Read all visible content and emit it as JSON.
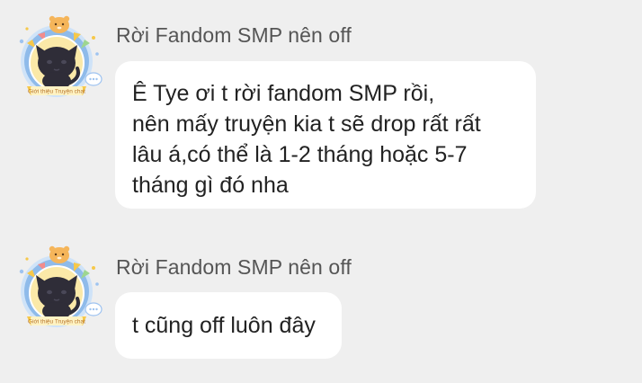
{
  "messages": [
    {
      "sender": "Rời Fandom SMP nên off",
      "lines": [
        "Ê Tye ơi t rời fandom SMP rồi,",
        "nên mấy truyện kia t sẽ drop rất rất",
        "lâu á,có thể là 1-2 tháng hoặc 5-7",
        "tháng gì đó nha"
      ],
      "avatar_banner": "Giới thiệu Truyện chat"
    },
    {
      "sender": "Rời Fandom SMP nên off",
      "lines": [
        "t cũng off luôn đây"
      ],
      "avatar_banner": "Giới thiệu Truyện chat"
    }
  ],
  "icons": {
    "avatar": "cat-avatar-icon",
    "frame": "avatar-frame-icon",
    "chat": "chat-bubble-icon"
  },
  "colors": {
    "background": "#efefef",
    "bubble": "#ffffff",
    "sender_text": "#555555",
    "message_text": "#222222",
    "frame_blue": "#7fb0e8",
    "frame_yellow": "#f6c84a",
    "cat": "#2f2d38"
  }
}
